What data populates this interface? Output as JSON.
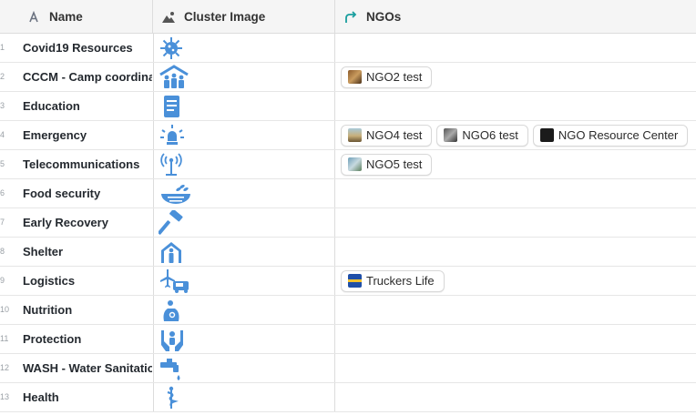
{
  "columns": {
    "name": "Name",
    "cluster_image": "Cluster Image",
    "ngos": "NGOs"
  },
  "rows": [
    {
      "num": "1",
      "name": "Covid19 Resources",
      "icon": "virus-icon",
      "ngos": []
    },
    {
      "num": "2",
      "name": "CCCM - Camp coordination",
      "icon": "camp-shelter-people-icon",
      "ngos": [
        "NGO2 test"
      ]
    },
    {
      "num": "3",
      "name": "Education",
      "icon": "book-icon",
      "ngos": []
    },
    {
      "num": "4",
      "name": "Emergency",
      "icon": "alarm-light-icon",
      "ngos": [
        "NGO4 test",
        "NGO6 test",
        "NGO Resource Center"
      ]
    },
    {
      "num": "5",
      "name": "Telecommunications",
      "icon": "antenna-icon",
      "ngos": [
        "NGO5 test"
      ]
    },
    {
      "num": "6",
      "name": "Food security",
      "icon": "food-bowl-icon",
      "ngos": []
    },
    {
      "num": "7",
      "name": "Early Recovery",
      "icon": "hammer-icon",
      "ngos": []
    },
    {
      "num": "8",
      "name": "Shelter",
      "icon": "shelter-icon",
      "ngos": []
    },
    {
      "num": "9",
      "name": "Logistics",
      "icon": "plane-truck-icon",
      "ngos": [
        "Truckers Life"
      ]
    },
    {
      "num": "10",
      "name": "Nutrition",
      "icon": "nutrition-icon",
      "ngos": []
    },
    {
      "num": "11",
      "name": "Protection",
      "icon": "protection-hands-icon",
      "ngos": []
    },
    {
      "num": "12",
      "name": "WASH - Water Sanitation",
      "icon": "water-tap-icon",
      "ngos": []
    },
    {
      "num": "13",
      "name": "Health",
      "icon": "health-icon",
      "ngos": []
    }
  ],
  "colors": {
    "icon_blue": "#4a90d9",
    "header_bg": "#f5f5f5",
    "ngo_header_icon": "#1a9e9e"
  }
}
